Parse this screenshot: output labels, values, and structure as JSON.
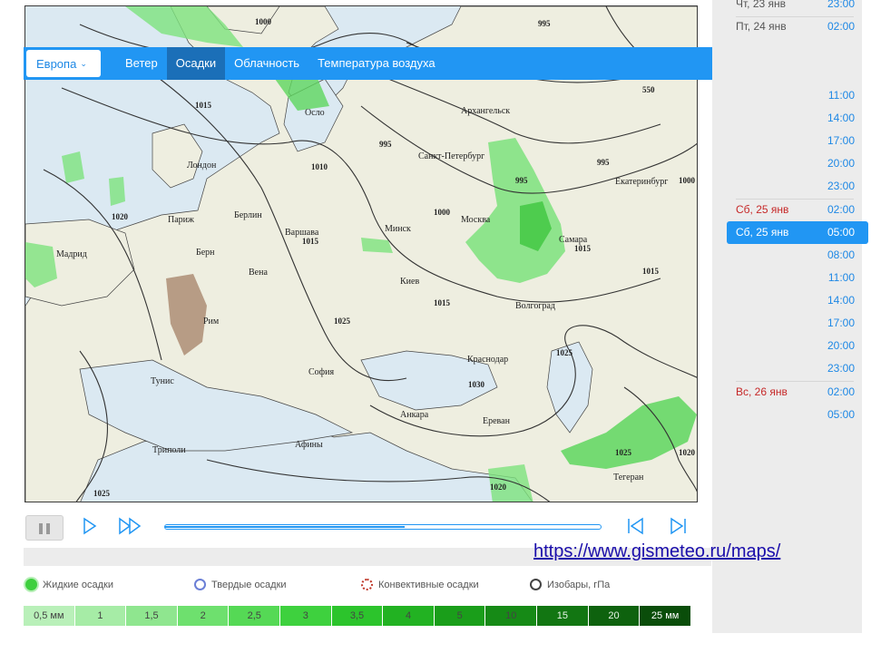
{
  "tabs": {
    "region": "Европа",
    "wind": "Ветер",
    "precip": "Осадки",
    "clouds": "Облачность",
    "temp": "Температура воздуха"
  },
  "timeline": [
    {
      "day": "Чт, 23 янв",
      "hour": "23:00"
    },
    {
      "day": "Пт, 24 янв",
      "hour": "02:00"
    },
    {
      "day": "",
      "hour": "11:00"
    },
    {
      "day": "",
      "hour": "14:00"
    },
    {
      "day": "",
      "hour": "17:00"
    },
    {
      "day": "",
      "hour": "20:00"
    },
    {
      "day": "",
      "hour": "23:00"
    },
    {
      "day": "Сб, 25 янв",
      "hour": "02:00"
    },
    {
      "day": "Сб, 25 янв",
      "hour": "05:00"
    },
    {
      "day": "",
      "hour": "08:00"
    },
    {
      "day": "",
      "hour": "11:00"
    },
    {
      "day": "",
      "hour": "14:00"
    },
    {
      "day": "",
      "hour": "17:00"
    },
    {
      "day": "",
      "hour": "20:00"
    },
    {
      "day": "",
      "hour": "23:00"
    },
    {
      "day": "Вс, 26 янв",
      "hour": "02:00"
    },
    {
      "day": "",
      "hour": "05:00"
    }
  ],
  "player": {
    "progress": 0.55
  },
  "url": "https://www.gismeteo.ru/maps/",
  "legend": {
    "liquid": "Жидкие осадки",
    "solid": "Твердые осадки",
    "convective": "Конвективные осадки",
    "isobars": "Изобары, гПа"
  },
  "scale": [
    "0,5 мм",
    "1",
    "1,5",
    "2",
    "2,5",
    "3",
    "3,5",
    "4",
    "5",
    "10",
    "15",
    "20",
    "25 мм"
  ],
  "scale_colors": [
    "#b9f0b9",
    "#a6eca6",
    "#8fe68f",
    "#6ee06e",
    "#55d955",
    "#3ed13e",
    "#2cc42c",
    "#22b222",
    "#1a9e1a",
    "#168a16",
    "#127612",
    "#0e620e",
    "#0a4d0a"
  ],
  "cities": [
    "Осло",
    "Архангельск",
    "Санкт-Петербург",
    "Лондон",
    "Екатеринбург",
    "Париж",
    "Берлин",
    "Варшава",
    "Минск",
    "Москва",
    "Мадрид",
    "Берн",
    "Вена",
    "Самара",
    "Киев",
    "Рим",
    "Волгоград",
    "София",
    "Краснодар",
    "Тунис",
    "Анкара",
    "Ереван",
    "Триполи",
    "Афины",
    "Тегеран"
  ],
  "isobars": [
    "995",
    "1000",
    "1015",
    "550",
    "995",
    "995",
    "1010",
    "995",
    "1000",
    "1020",
    "1015",
    "1015",
    "1010",
    "1025",
    "1025",
    "1030",
    "1020",
    "1025",
    "1025",
    "1020",
    "1000",
    "1015"
  ]
}
